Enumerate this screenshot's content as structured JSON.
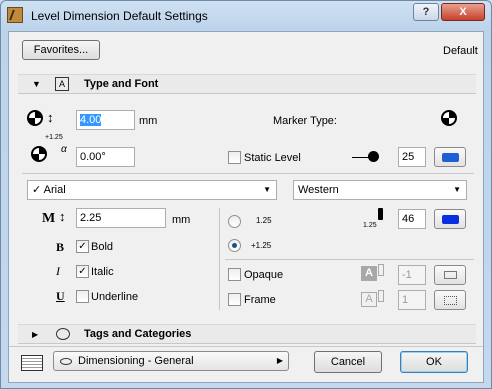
{
  "window": {
    "title": "Level Dimension Default Settings"
  },
  "titlebar": {
    "help_label": "?",
    "close_label": "X"
  },
  "top": {
    "favorites_label": "Favorites...",
    "default_label": "Default"
  },
  "type_font": {
    "header": "Type and Font",
    "height_value": "4.00",
    "height_unit": "mm",
    "angle_value": "0.00°",
    "angle_icon_text": "+1.25",
    "marker_label": "Marker Type:",
    "static_level_label": "Static Level",
    "marker_pen_value": "25",
    "font_name": "Arial",
    "script_name": "Western",
    "text_size_value": "2.25",
    "text_size_unit": "mm",
    "bold_label": "Bold",
    "italic_label": "Italic",
    "underline_label": "Underline",
    "bold_checked": true,
    "italic_checked": true,
    "underline_checked": false,
    "radio1_label": "1.25",
    "radio2_label": "+1.25",
    "selected_radio": 2,
    "text_pen_value": "46",
    "text_pen_icon_text": "1.25",
    "opaque_label": "Opaque",
    "opaque_pen_value": "-1",
    "frame_label": "Frame",
    "frame_pen_value": "1",
    "bold_icon": "B",
    "italic_icon": "I",
    "underline_icon": "U",
    "text_size_icon": "M",
    "font_check": "✓"
  },
  "tags": {
    "header": "Tags and Categories"
  },
  "bottom": {
    "layer_value": "Dimensioning - General",
    "cancel_label": "Cancel",
    "ok_label": "OK"
  },
  "colors": {
    "pen_blue": "#1f5fd6",
    "pen_blue2": "#0a2fe0"
  }
}
